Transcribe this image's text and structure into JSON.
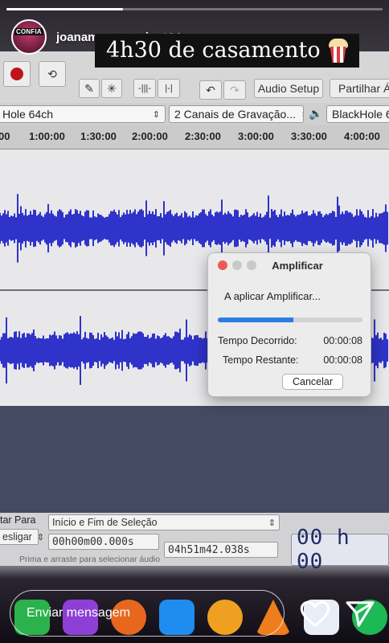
{
  "story": {
    "progress_fraction": 0.31,
    "username": "joanamarquespic",
    "time_ago": "13 h",
    "avatar_tag": "CONFIA",
    "caption": "4h30 de casamento",
    "reply_placeholder": "Enviar mensagem"
  },
  "audacity": {
    "toolbar": {
      "audio_setup_label": "Audio Setup",
      "share_label": "Partilhar Ám"
    },
    "device_row": {
      "input_device": "Hole 64ch",
      "channels": "2 Canais de Gravação...",
      "output_device": "BlackHole 6"
    },
    "ruler_ticks": [
      "00",
      "1:00:00",
      "1:30:00",
      "2:00:00",
      "2:30:00",
      "3:00:00",
      "3:30:00",
      "4:00:00"
    ],
    "dialog": {
      "title": "Amplificar",
      "message": "A aplicar Amplificar...",
      "progress_fraction": 0.52,
      "elapsed_label": "Tempo Decorrido:",
      "elapsed_value": "00:00:08",
      "remaining_label": "Tempo Restante:",
      "remaining_value": "00:00:08",
      "cancel_label": "Cancelar"
    },
    "selection_toolbar": {
      "snap_label": "tar Para",
      "snap_value": "esligar",
      "mode_value": "Início e Fim de Seleção",
      "start_time": "00h00m00.000s",
      "end_time": "04h51m42.038s",
      "hint": "Prima e arraste para selecionar áudio",
      "big_time": "00 h 00"
    }
  },
  "colors": {
    "waveform": "#2f33c9",
    "progress_blue": "#2f7de0",
    "record_red": "#c0141b",
    "caption_bg": "#111111"
  },
  "icons": [
    "record-icon",
    "loop-icon",
    "pencil-icon",
    "multi-tool-icon",
    "undo-icon",
    "redo-icon",
    "speaker-icon",
    "heart-icon",
    "send-icon",
    "popcorn-icon"
  ]
}
